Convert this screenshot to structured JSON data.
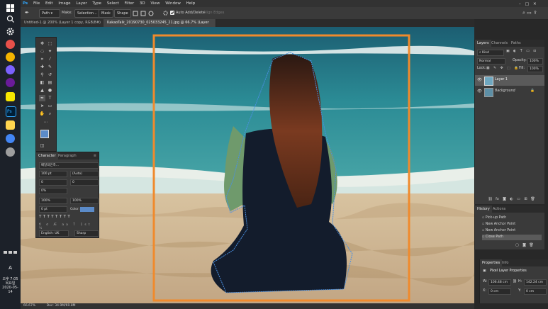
{
  "taskbar": {
    "time": "오후 7:05",
    "day": "목요일",
    "date": "2020-05-14",
    "input_indicator": "A"
  },
  "menubar": {
    "items": [
      "File",
      "Edit",
      "Image",
      "Layer",
      "Type",
      "Select",
      "Filter",
      "3D",
      "View",
      "Window",
      "Help"
    ]
  },
  "options": {
    "mode": "Path",
    "make_label": "Make:",
    "selection": "Selection...",
    "mask": "Mask",
    "shape": "Shape",
    "auto_add_delete": "Auto Add/Delete",
    "align_edges": "Align Edges"
  },
  "tabs": [
    {
      "label": "Untitled-1 @ 200% (Layer 1 copy, RGB/8#) *"
    },
    {
      "label": "KakaoTalk_20190730_025033245_21.jpg @ 66.7% (Layer 1, RGB/8*) *"
    }
  ],
  "status": {
    "zoom": "66.67%",
    "doc": "Doc: 34.9M/69.8M"
  },
  "character": {
    "tab1": "Character",
    "tab2": "Paragraph",
    "font": "배달의민족...",
    "size": "100 pt",
    "leading": "(Auto)",
    "kerning": "0",
    "tracking": "0",
    "scale_v": "0%",
    "scale_v2": "100%",
    "scale_h": "100%",
    "baseline": "0 pt",
    "color_label": "Color:",
    "language": "English: UK",
    "aa": "Sharp"
  },
  "layers": {
    "tab1": "Layers",
    "tab2": "Channels",
    "tab3": "Paths",
    "filter": "Kind",
    "blend": "Normal",
    "opacity_label": "Opacity:",
    "opacity": "100%",
    "lock_label": "Lock:",
    "fill_label": "Fill:",
    "fill": "100%",
    "items": [
      {
        "name": "Layer 1"
      },
      {
        "name": "Background"
      }
    ]
  },
  "history": {
    "tab1": "History",
    "tab2": "Actions",
    "items": [
      "Pick-up Path",
      "New Anchor Point",
      "New Anchor Point",
      "Close Path"
    ]
  },
  "properties": {
    "tab1": "Properties",
    "tab2": "Info",
    "title": "Pixel Layer Properties",
    "w_label": "W:",
    "w": "106.48 cm",
    "h_label": "H:",
    "h": "142.24 cm",
    "x_label": "X:",
    "x": "0 cm",
    "y_label": "Y:",
    "y": "0 cm"
  },
  "colors": {
    "accent": "#f08a2c",
    "selection_blue": "#4a90e2",
    "panel_bg": "#3a3a3a"
  }
}
